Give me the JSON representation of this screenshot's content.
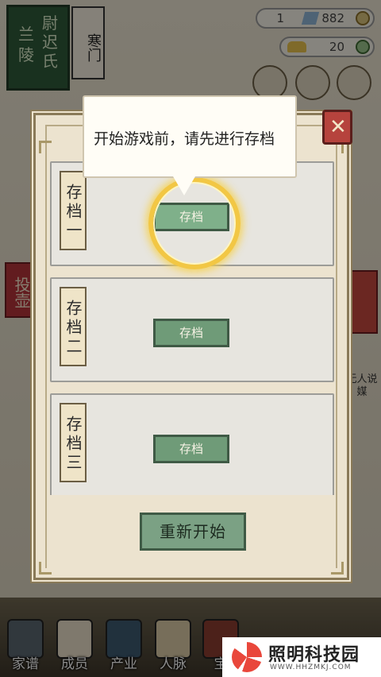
{
  "title": {
    "plaque_chars": [
      "尉",
      "迟",
      "兰",
      "陵",
      "氏"
    ],
    "name": "寒门"
  },
  "resources": {
    "gems": "1",
    "silver": "882",
    "gold": "20"
  },
  "side": {
    "left_tag": "投壶",
    "right_text": "无人说媒"
  },
  "dialog": {
    "tooltip": "开始游戏前，请先进行存档",
    "slots": [
      {
        "label": "存档一",
        "button": "存档"
      },
      {
        "label": "存档二",
        "button": "存档"
      },
      {
        "label": "存档三",
        "button": "存档"
      }
    ],
    "restart_label": "重新开始"
  },
  "bottom_nav": [
    "家谱",
    "成员",
    "产业",
    "人脉",
    "宝"
  ],
  "watermark": {
    "name": "照明科技园",
    "url": "WWW.HHZMKJ.COM"
  },
  "colors": {
    "accent_green": "#6f9b78",
    "accent_red": "#b6433d",
    "highlight": "#f2c744"
  }
}
